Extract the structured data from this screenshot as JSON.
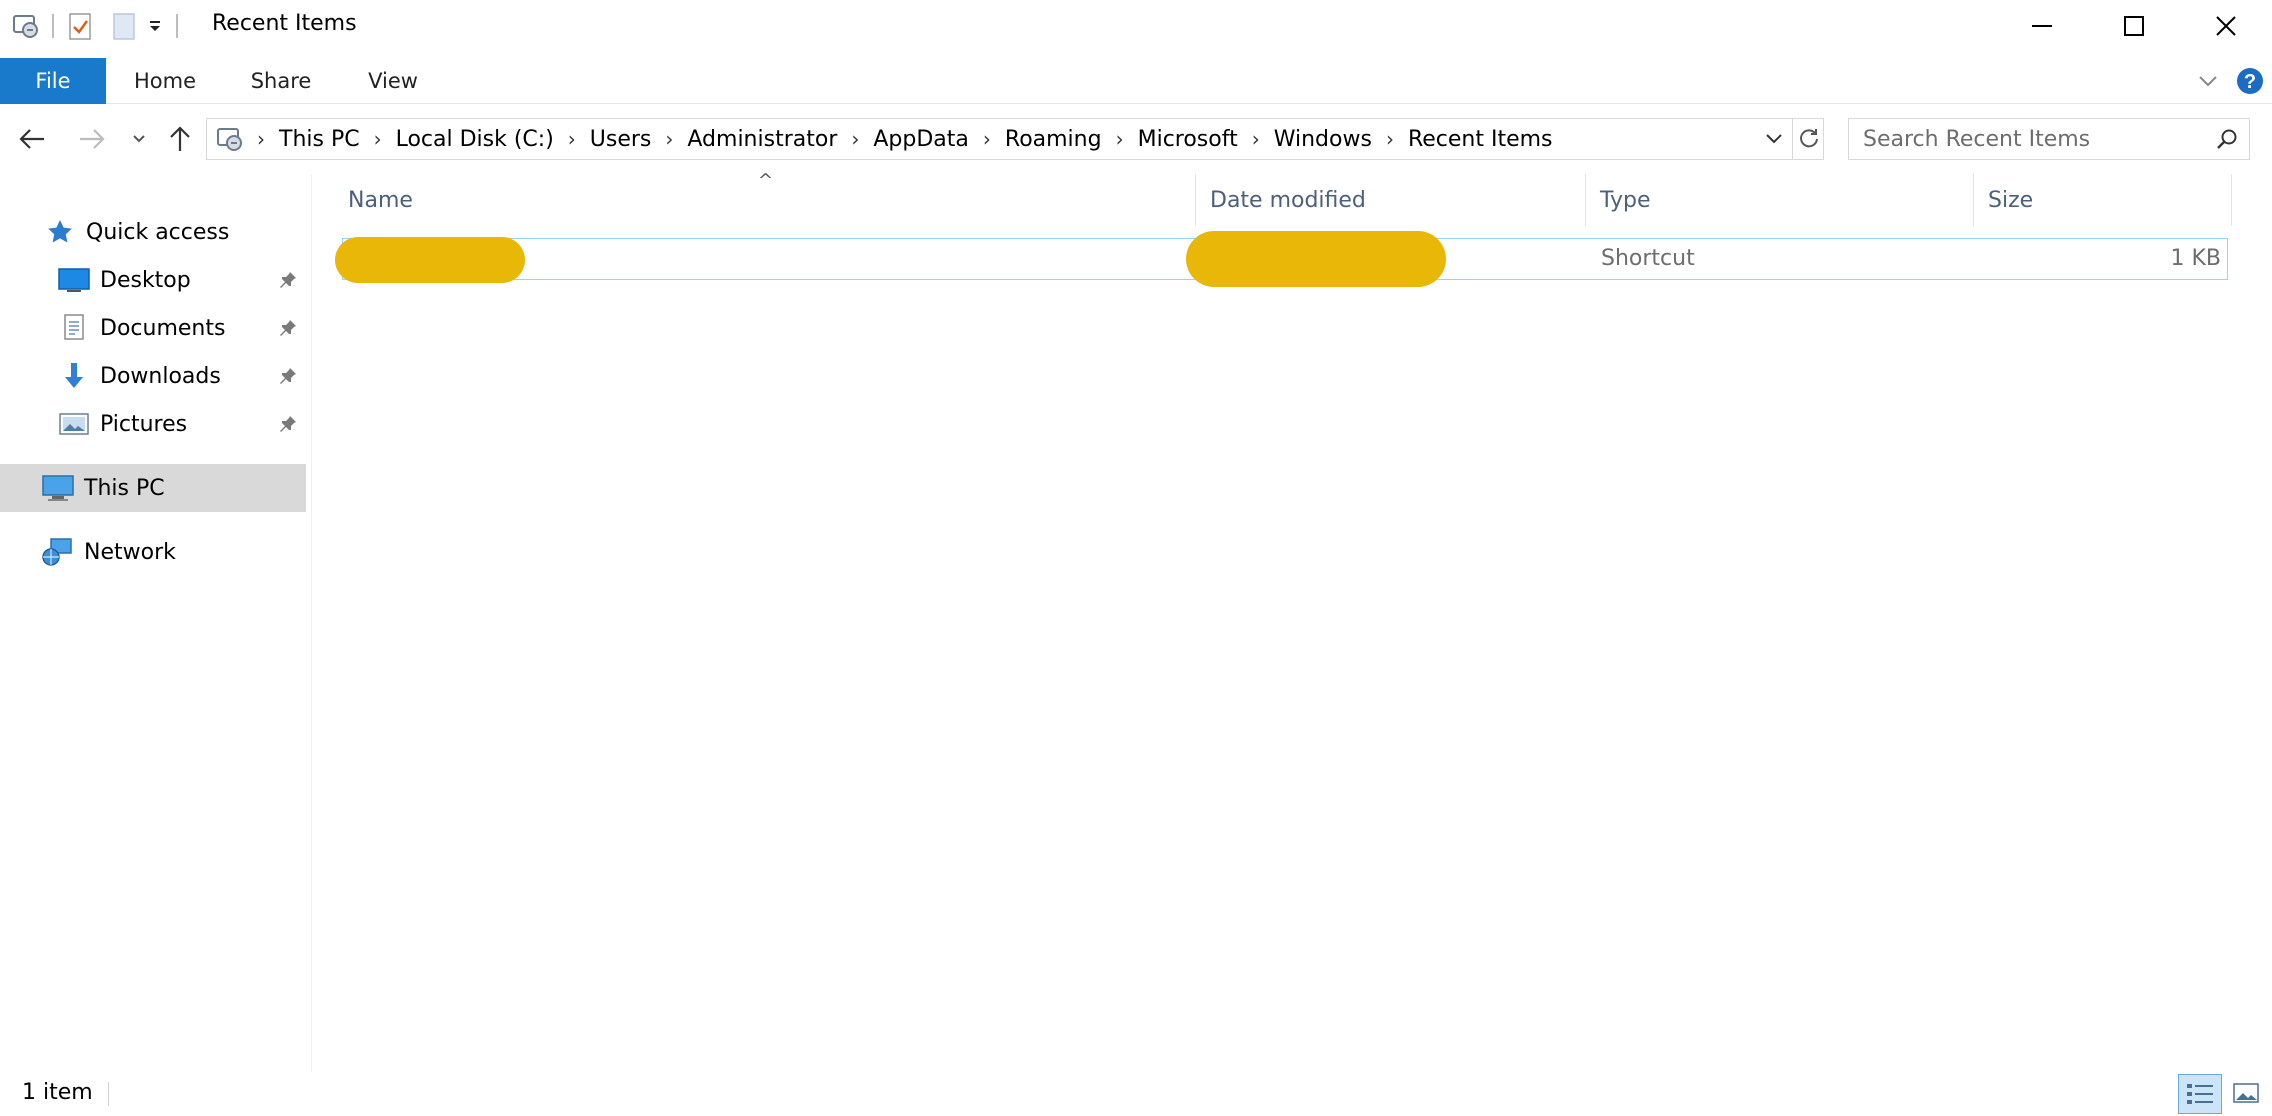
{
  "window": {
    "title": "Recent Items",
    "controls": {
      "minimize": "minimize-icon",
      "maximize": "maximize-icon",
      "close": "close-icon"
    }
  },
  "quick_access_toolbar": {
    "icons": [
      "explorer-icon",
      "properties-icon",
      "new-folder-icon",
      "customize-dropdown-icon"
    ]
  },
  "ribbon": {
    "tabs": [
      {
        "label": "File",
        "active": true
      },
      {
        "label": "Home"
      },
      {
        "label": "Share"
      },
      {
        "label": "View"
      }
    ],
    "accent": "#1979ca"
  },
  "address_bar": {
    "breadcrumbs": [
      "This PC",
      "Local Disk (C:)",
      "Users",
      "Administrator",
      "AppData",
      "Roaming",
      "Microsoft",
      "Windows",
      "Recent Items"
    ]
  },
  "search": {
    "placeholder": "Search Recent Items"
  },
  "nav_pane": {
    "quick_access": "Quick access",
    "pinned": [
      {
        "label": "Desktop",
        "icon": "desktop-icon"
      },
      {
        "label": "Documents",
        "icon": "documents-icon"
      },
      {
        "label": "Downloads",
        "icon": "downloads-icon"
      },
      {
        "label": "Pictures",
        "icon": "pictures-icon"
      }
    ],
    "this_pc": "This PC",
    "network": "Network"
  },
  "file_list": {
    "columns": {
      "name": "Name",
      "date_modified": "Date modified",
      "type": "Type",
      "size": "Size"
    },
    "sort_indicator": "^",
    "rows": [
      {
        "type": "Shortcut",
        "size": "1 KB"
      }
    ]
  },
  "status_bar": {
    "item_count": "1 item"
  }
}
